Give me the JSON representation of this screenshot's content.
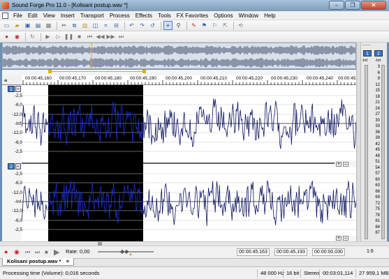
{
  "window": {
    "title": "Sound Forge Pro 11.0 - [Kolisani postup.wav *]",
    "min_label": "–",
    "max_label": "❐",
    "close_label": "✕"
  },
  "menu": [
    "File",
    "Edit",
    "View",
    "Insert",
    "Transport",
    "Process",
    "Effects",
    "Tools",
    "FX Favorites",
    "Options",
    "Window",
    "Help"
  ],
  "toolbar1": {
    "icons": [
      "new-icon",
      "open-icon",
      "save-icon",
      "save-all-icon",
      "properties-icon",
      "cut-icon",
      "copy-icon",
      "paste-icon",
      "mix-icon",
      "crop-icon",
      "trim-icon",
      "undo-icon",
      "redo-icon",
      "repeat-icon",
      "edit-tool-icon",
      "magnify-tool-icon",
      "pencil-tool-icon",
      "envelope-tool-icon",
      "event-tool-icon",
      "snap-icon",
      "loop-icon"
    ]
  },
  "toolbar2": {
    "icons": [
      "record-icon",
      "record-arm-icon",
      "loop-playback-icon",
      "play-all-icon",
      "play-icon",
      "pause-icon",
      "stop-icon",
      "go-start-icon",
      "rewind-icon",
      "forward-icon",
      "go-end-icon"
    ]
  },
  "ruler": {
    "labels": [
      "00:00:45,160",
      "00:00:45,170",
      "00:00:45,180",
      "00:00:45,190",
      "00:00:45,200",
      "00:00:45,210",
      "00:00:45,220",
      "00:00:45,230",
      "00:00:45,240",
      "00:00:45,250"
    ]
  },
  "channels": [
    {
      "number": "1",
      "toggle": "–",
      "scale": [
        "-2,5",
        "-6,0",
        "-12,0",
        "-Inf.",
        "-12,0",
        "-6,0",
        "-2,5"
      ]
    },
    {
      "number": "2",
      "toggle": "–",
      "scale": [
        "-2,5",
        "-6,0",
        "-12,0",
        "-Inf.",
        "-12,0",
        "-6,0",
        "-2,5"
      ]
    }
  ],
  "meter": {
    "header": "------",
    "channel_buttons": [
      "1",
      "2"
    ],
    "peaks": [
      "-Inf.",
      "-Inf."
    ],
    "scale": [
      "3",
      "6",
      "9",
      "12",
      "15",
      "18",
      "21",
      "24",
      "27",
      "30",
      "33",
      "36",
      "39",
      "42",
      "45",
      "48",
      "51",
      "54",
      "57",
      "60",
      "63",
      "66",
      "69",
      "72",
      "75",
      "78",
      "81",
      "84",
      "87"
    ]
  },
  "transport": {
    "rate_label": "Rate: 0,00",
    "selection_start": "00:00:45,163",
    "selection_end": "00:00:45,193",
    "selection_length": "00:00:00,030",
    "zoom_ratio": "1:6"
  },
  "tab": {
    "label": "Kolisani postup.wav *",
    "close": "×"
  },
  "status": {
    "message": "Processing time (Volume): 0,016 seconds",
    "sample_rate": "48 000 Hz",
    "bit_depth": "16 bit",
    "channels": "Stereo",
    "length": "00:03:01,114",
    "free_space": "27 959,1 MB"
  },
  "colors": {
    "selection_bg": "#000000",
    "wave_selected": "#1b2fd6",
    "wave_normal": "#0d1460",
    "accent": "#3a6fc7"
  }
}
